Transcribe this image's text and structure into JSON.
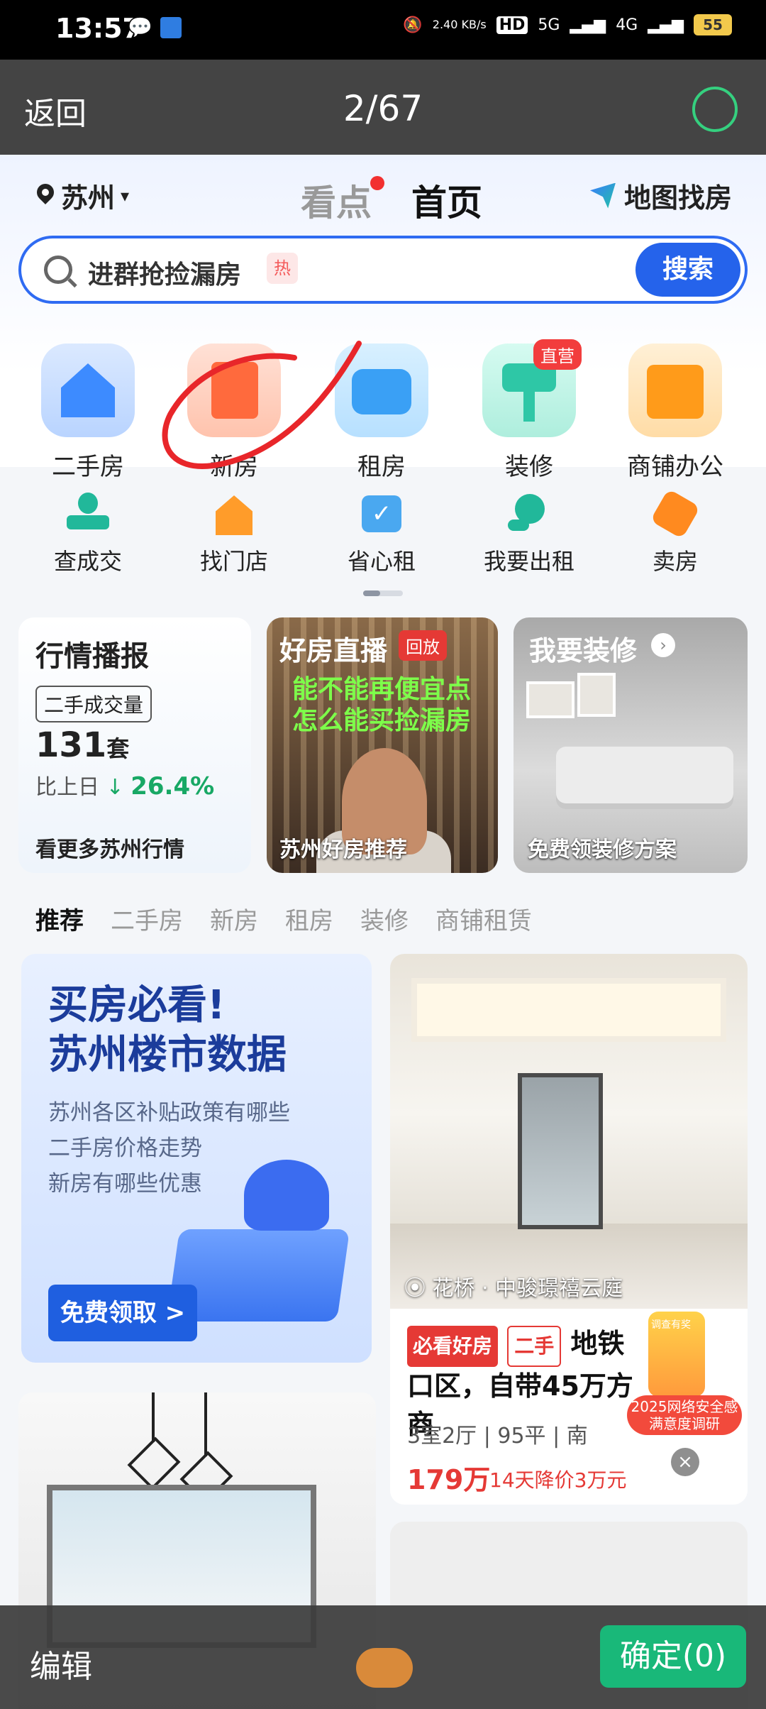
{
  "status_bar": {
    "time": "13:57",
    "net_speed": "2.40 KB/s",
    "hd_label": "HD",
    "signal1": "5G",
    "signal2": "4G",
    "battery": "55"
  },
  "viewer": {
    "back_label": "返回",
    "counter": "2/67",
    "edit_label": "编辑",
    "confirm_label": "确定(0)"
  },
  "header": {
    "city": "苏州",
    "tab_watch": "看点",
    "tab_home": "首页",
    "map_label": "地图找房"
  },
  "search": {
    "text": "进群抢捡漏房",
    "hot_badge": "热",
    "button": "搜索"
  },
  "categories": [
    {
      "label": "二手房",
      "icon": "house-icon",
      "color": "#3d8bff"
    },
    {
      "label": "新房",
      "icon": "building-icon",
      "color": "#ff6a3d"
    },
    {
      "label": "租房",
      "icon": "sofa-icon",
      "color": "#3aa0f5"
    },
    {
      "label": "装修",
      "icon": "paint-roller-icon",
      "color": "#2ec7a6",
      "badge": "直营"
    },
    {
      "label": "商铺办公",
      "icon": "shop-icon",
      "color": "#ff9b1a"
    }
  ],
  "sub_categories": [
    {
      "label": "查成交",
      "icon": "stamp-icon"
    },
    {
      "label": "找门店",
      "icon": "store-search-icon"
    },
    {
      "label": "省心租",
      "icon": "check-card-icon"
    },
    {
      "label": "我要出租",
      "icon": "key-icon"
    },
    {
      "label": "卖房",
      "icon": "tag-icon"
    }
  ],
  "cards": {
    "market": {
      "title": "行情播报",
      "pill": "二手成交量",
      "count": "131",
      "unit": "套",
      "compare_label": "比上日",
      "percent": "26.4%",
      "more": "看更多苏州行情"
    },
    "live": {
      "title": "好房直播",
      "replay": "回放",
      "caption_line1": "能不能再便宜点",
      "caption_line2": "怎么能买捡漏房",
      "bottom": "苏州好房推荐"
    },
    "decor": {
      "title": "我要装修",
      "bottom": "免费领装修方案"
    }
  },
  "filter_tabs": [
    "推荐",
    "二手房",
    "新房",
    "租房",
    "装修",
    "商铺租赁"
  ],
  "promo": {
    "headline_1": "买房必看!",
    "headline_2": "苏州楼市数据",
    "bullet_1": "苏州各区补贴政策有哪些",
    "bullet_2": "二手房价格走势",
    "bullet_3": "新房有哪些优惠",
    "button": "免费领取 >"
  },
  "listing": {
    "location": "花桥 · 中骏璟禧云庭",
    "tag_must": "必看好房",
    "tag_type": "二手",
    "title": "地铁口区，自带45万方商",
    "spec": "3室2厅 | 95平 | 南",
    "price": "179万",
    "price_drop": "14天降价3万元"
  },
  "survey": {
    "top_label": "调查有奖",
    "line1": "2025网络安全感",
    "line2": "满意度调研"
  },
  "colors": {
    "accent": "#2563eb",
    "price_red": "#e53935",
    "confirm_green": "#19b879",
    "annotation_red": "#e8262a"
  }
}
